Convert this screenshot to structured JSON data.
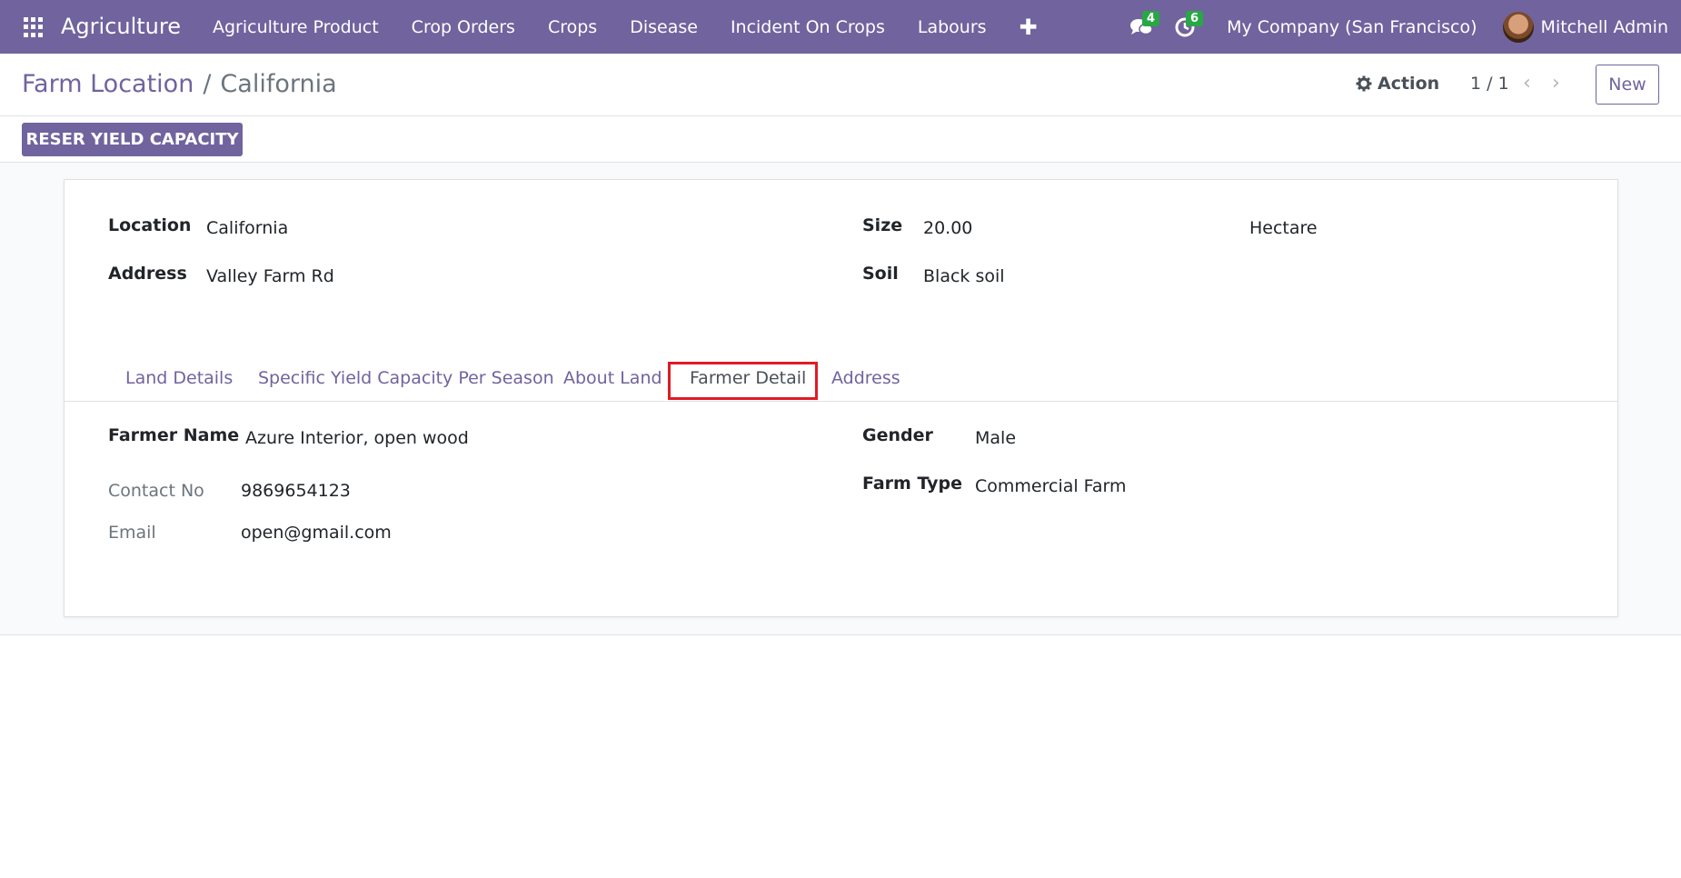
{
  "navbar": {
    "brand": "Agriculture",
    "menu": [
      "Agriculture Product",
      "Crop Orders",
      "Crops",
      "Disease",
      "Incident On Crops",
      "Labours"
    ],
    "plus": "✚",
    "messages_badge": "4",
    "activities_badge": "6",
    "company": "My Company (San Francisco)",
    "user": "Mitchell Admin"
  },
  "control": {
    "breadcrumb_parent": "Farm Location",
    "breadcrumb_sep": "/",
    "breadcrumb_current": "California",
    "action_label": "Action",
    "pager": "1 / 1",
    "prev_icon": "‹",
    "next_icon": "›",
    "new_label": "New"
  },
  "statusbar": {
    "reser_label": "RESER YIELD CAPACITY"
  },
  "form": {
    "location_label": "Location",
    "location_value": "California",
    "address_label": "Address",
    "address_value": "Valley Farm Rd",
    "size_label": "Size",
    "size_value": "20.00",
    "size_unit": "Hectare",
    "soil_label": "Soil",
    "soil_value": "Black soil"
  },
  "tabs": [
    "Land Details",
    "Specific Yield Capacity Per Season",
    "About Land",
    "Farmer Detail",
    "Address"
  ],
  "farmer": {
    "name_label": "Farmer Name",
    "name_value": "Azure Interior, open wood",
    "contact_label": "Contact No",
    "contact_value": "9869654123",
    "email_label": "Email",
    "email_value": "open@gmail.com",
    "gender_label": "Gender",
    "gender_value": "Male",
    "farm_type_label": "Farm Type",
    "farm_type_value": "Commercial Farm"
  },
  "colors": {
    "brand": "#71639e",
    "highlight": "#e01b24",
    "badge": "#28a745"
  }
}
